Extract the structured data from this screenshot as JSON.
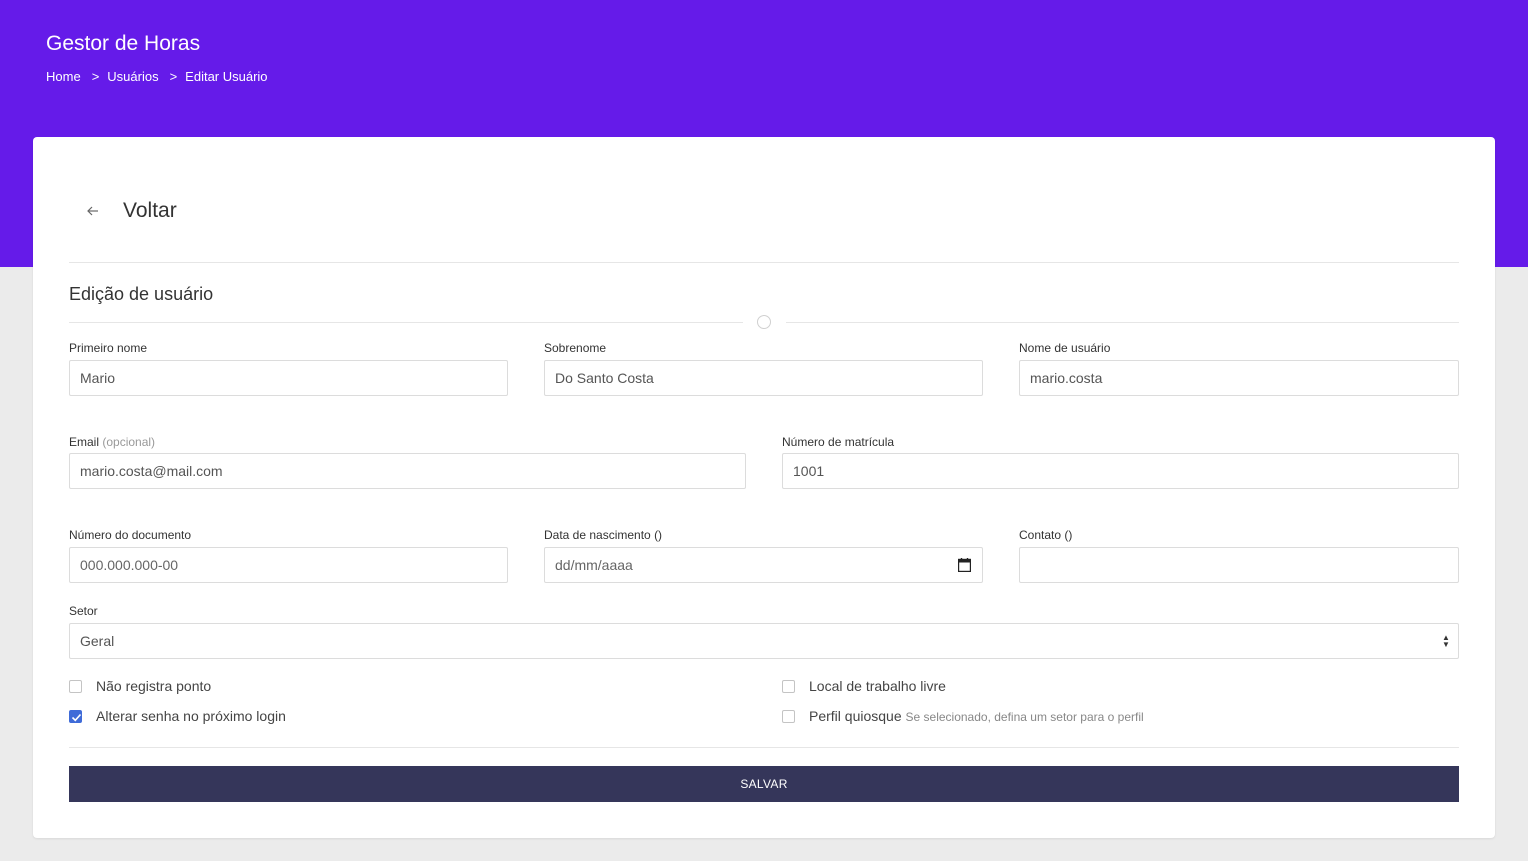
{
  "header": {
    "app_title": "Gestor de Horas",
    "breadcrumb": [
      {
        "label": "Home"
      },
      {
        "label": "Usuários"
      },
      {
        "label": "Editar Usuário"
      }
    ],
    "separator": ">"
  },
  "back": {
    "label": "Voltar",
    "icon": "arrow-left-icon"
  },
  "form": {
    "title": "Edição de usuário",
    "fields": {
      "first_name": {
        "label": "Primeiro nome",
        "value": "Mario"
      },
      "last_name": {
        "label": "Sobrenome",
        "value": "Do Santo Costa"
      },
      "username": {
        "label": "Nome de usuário",
        "value": "mario.costa"
      },
      "email": {
        "label": "Email",
        "optional": "(opcional)",
        "value": "mario.costa@mail.com"
      },
      "registration": {
        "label": "Número de matrícula",
        "value": "1001"
      },
      "document": {
        "label": "Número do documento",
        "placeholder": "000.000.000-00",
        "value": ""
      },
      "birth_date": {
        "label": "Data de nascimento ()",
        "placeholder": "dd/mm/aaaa",
        "value": ""
      },
      "contact": {
        "label": "Contato ()",
        "value": ""
      },
      "sector": {
        "label": "Setor",
        "selected": "Geral"
      }
    },
    "checkboxes": {
      "no_clock": {
        "label": "Não registra ponto",
        "checked": false
      },
      "change_password": {
        "label": "Alterar senha no próximo login",
        "checked": true
      },
      "free_workplace": {
        "label": "Local de trabalho livre",
        "checked": false
      },
      "kiosk_profile": {
        "label": "Perfil quiosque",
        "hint": "Se selecionado, defina um setor para o perfil",
        "checked": false
      }
    },
    "save_label": "SALVAR"
  },
  "colors": {
    "header_bg": "#651be9",
    "button_bg": "#35365a",
    "checkbox_checked": "#3f6bd8"
  }
}
